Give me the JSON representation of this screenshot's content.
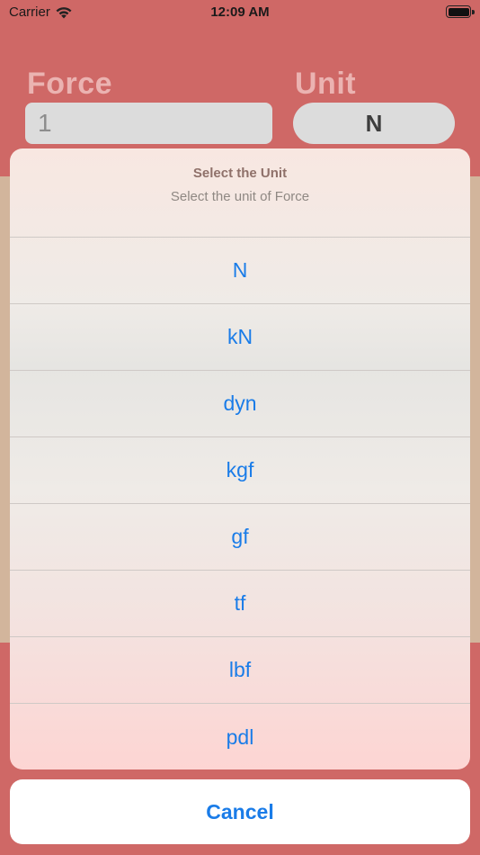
{
  "status_bar": {
    "carrier": "Carrier",
    "time": "12:09 AM",
    "wifi_icon": "wifi-icon",
    "battery_icon": "battery-icon"
  },
  "page": {
    "force_label": "Force",
    "unit_label": "Unit",
    "force_value": "1",
    "unit_value": "N",
    "colors": {
      "background": "#cf6866",
      "band": "#d2b59c",
      "field": "#dcdcdc"
    }
  },
  "action_sheet": {
    "title": "Select the Unit",
    "message": "Select the unit of Force",
    "options": [
      "N",
      "kN",
      "dyn",
      "kgf",
      "gf",
      "tf",
      "lbf",
      "pdl"
    ],
    "cancel_label": "Cancel",
    "accent_color": "#1a7ce8"
  }
}
